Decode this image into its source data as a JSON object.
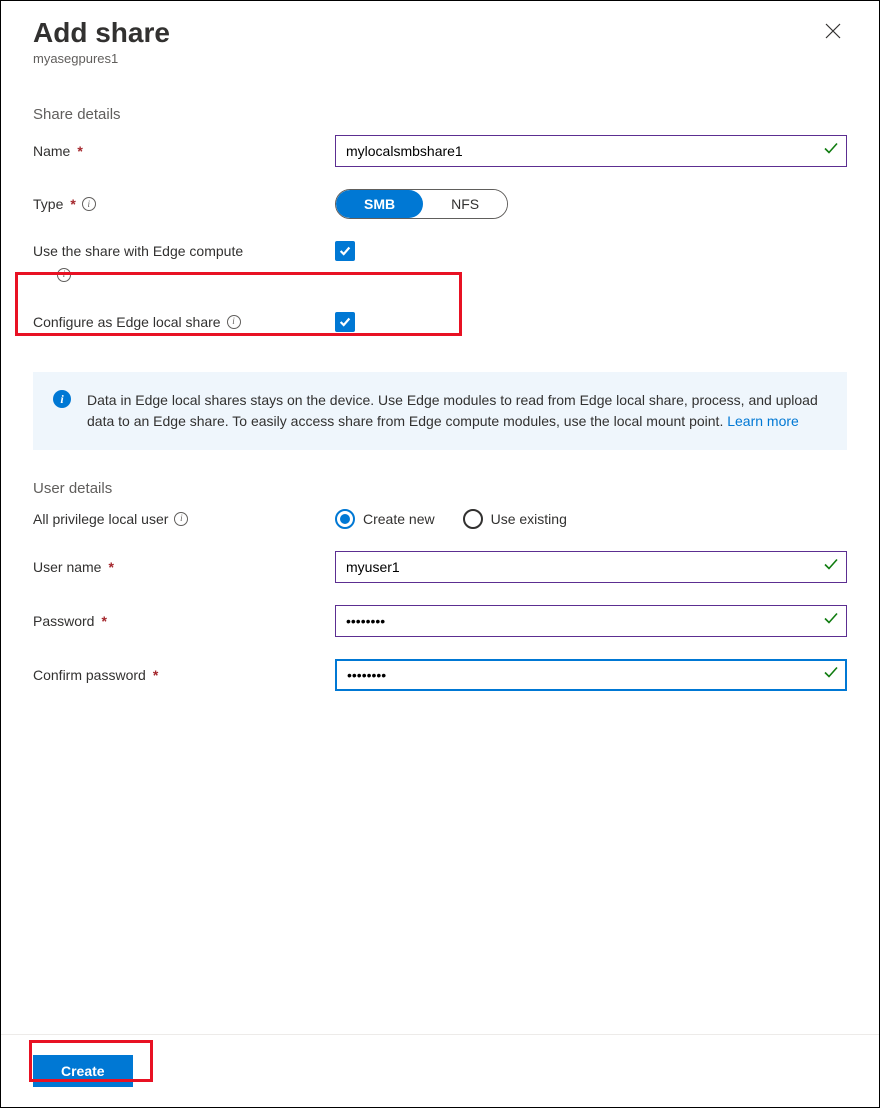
{
  "header": {
    "title": "Add share",
    "subtitle": "myasegpures1"
  },
  "sections": {
    "share_details": "Share details",
    "user_details": "User details"
  },
  "labels": {
    "name": "Name",
    "type": "Type",
    "edge_compute": "Use the share with Edge compute",
    "edge_local": "Configure as Edge local share",
    "all_priv_user": "All privilege local user",
    "user_name": "User name",
    "password": "Password",
    "confirm_password": "Confirm password"
  },
  "fields": {
    "name_value": "mylocalsmbshare1",
    "type_options": {
      "smb": "SMB",
      "nfs": "NFS"
    },
    "type_selected": "SMB",
    "edge_compute_checked": true,
    "edge_local_checked": true,
    "user_mode": {
      "create_new": "Create new",
      "use_existing": "Use existing"
    },
    "user_mode_selected": "create_new",
    "user_name_value": "myuser1",
    "password_value": "••••••••",
    "confirm_password_value": "••••••••"
  },
  "callout": {
    "text": "Data in Edge local shares stays on the device. Use Edge modules to read from Edge local share, process, and upload data to an Edge share. To easily access share from Edge compute modules, use the local mount point. ",
    "link": "Learn more"
  },
  "footer": {
    "create": "Create"
  }
}
